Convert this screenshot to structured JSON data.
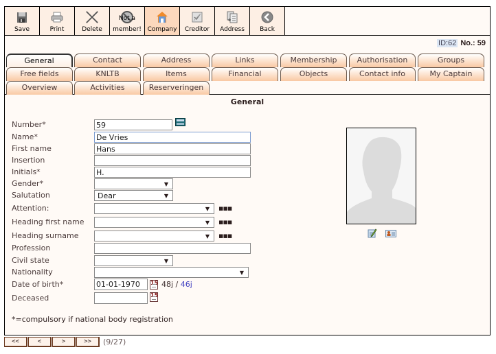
{
  "toolbar": {
    "buttons": [
      {
        "id": "save",
        "label": "Save",
        "icon": "floppy-disk-icon"
      },
      {
        "id": "print",
        "label": "Print",
        "icon": "printer-icon"
      },
      {
        "id": "delete",
        "label": "Delete",
        "icon": "x-icon"
      },
      {
        "id": "not-member",
        "label": "member!",
        "overlay": "Not a",
        "icon": "no-entry-icon"
      },
      {
        "id": "company",
        "label": "Company",
        "icon": "house-icon",
        "active": true
      },
      {
        "id": "creditor",
        "label": "Creditor",
        "icon": "checked-box-icon"
      },
      {
        "id": "address",
        "label": "Address",
        "icon": "address-document-icon"
      },
      {
        "id": "back",
        "label": "Back",
        "icon": "back-arrow-icon"
      }
    ]
  },
  "record": {
    "id_label": "ID:62",
    "no_label": "No.: 59"
  },
  "tabs": {
    "row1": [
      "General",
      "Contact",
      "Address",
      "Links",
      "Membership",
      "Authorisation",
      "Groups"
    ],
    "row2": [
      "Free fields",
      "KNLTB",
      "Items",
      "Financial",
      "Objects",
      "Contact info",
      "My Captain"
    ],
    "row3": [
      "Overview",
      "Activities",
      "Reserveringen"
    ],
    "active": "General"
  },
  "section_title": "General",
  "form": {
    "number": {
      "label": "Number*",
      "value": "59"
    },
    "name": {
      "label": "Name*",
      "value": "De Vries"
    },
    "first_name": {
      "label": "First name",
      "value": "Hans"
    },
    "insertion": {
      "label": "Insertion",
      "value": ""
    },
    "initials": {
      "label": "Initials*",
      "value": "H."
    },
    "gender": {
      "label": "Gender*",
      "value": ""
    },
    "salutation": {
      "label": "Salutation",
      "value": "Dear"
    },
    "attention": {
      "label": "Attention:",
      "value": ""
    },
    "heading_first_name": {
      "label": "Heading first name",
      "value": ""
    },
    "heading_surname": {
      "label": "Heading surname",
      "value": ""
    },
    "profession": {
      "label": "Profession",
      "value": ""
    },
    "civil_state": {
      "label": "Civil state",
      "value": ""
    },
    "nationality": {
      "label": "Nationality",
      "value": ""
    },
    "date_of_birth": {
      "label": "Date of birth*",
      "value": "01-01-1970",
      "age": "48j",
      "age_sep": " / ",
      "age2": "46j"
    },
    "deceased": {
      "label": "Deceased",
      "value": ""
    },
    "calendar_icon_text": "15",
    "more_text": "▪▪▪"
  },
  "footnote": "*=compulsory if national body registration",
  "pager": {
    "first": "<<",
    "prev": "<",
    "next": ">",
    "last": ">>",
    "count": "(9/27)"
  }
}
